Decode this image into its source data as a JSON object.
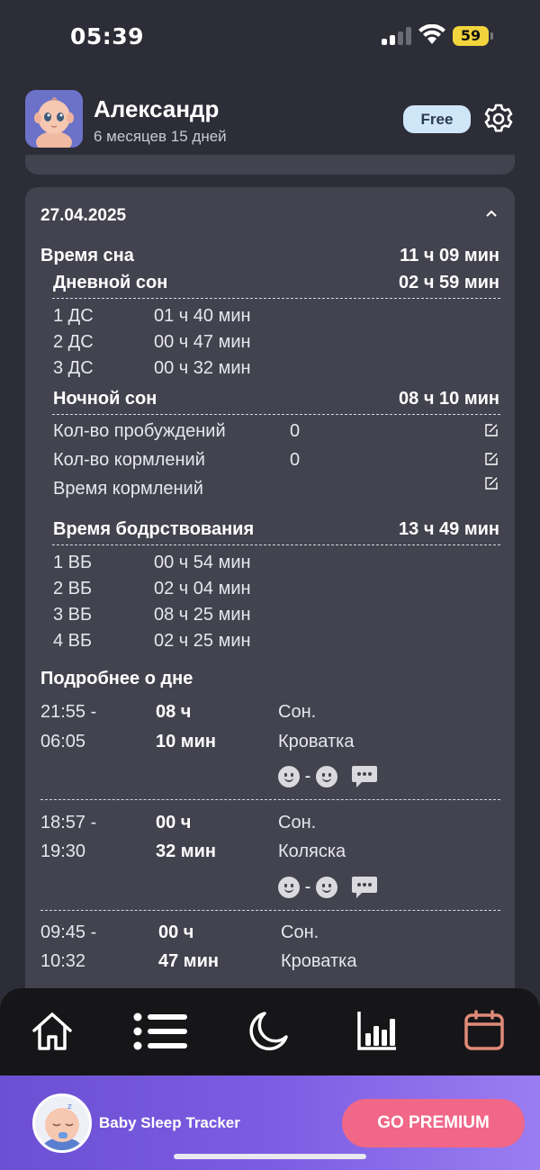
{
  "status_bar": {
    "time": "05:39",
    "battery": "59"
  },
  "header": {
    "name": "Александр",
    "age": "6 месяцев 15 дней",
    "plan_badge": "Free"
  },
  "card": {
    "date": "27.04.2025",
    "sleep_total": {
      "label": "Время сна",
      "value": "11 ч 09 мин"
    },
    "day_sleep": {
      "label": "Дневной сон",
      "value": "02 ч 59 мин",
      "items": [
        {
          "name": "1 ДС",
          "duration": "01 ч 40 мин"
        },
        {
          "name": "2 ДС",
          "duration": "00 ч 47 мин"
        },
        {
          "name": "3 ДС",
          "duration": "00 ч 32 мин"
        }
      ]
    },
    "night_sleep": {
      "label": "Ночной сон",
      "value": "08 ч 10 мин",
      "items": [
        {
          "name": "Кол-во пробуждений",
          "value": "0"
        },
        {
          "name": "Кол-во кормлений",
          "value": "0"
        },
        {
          "name": "Время кормлений",
          "value": ""
        }
      ]
    },
    "awake": {
      "label": "Время бодрствования",
      "value": "13 ч 49 мин",
      "items": [
        {
          "name": "1 ВБ",
          "duration": "00 ч 54 мин"
        },
        {
          "name": "2 ВБ",
          "duration": "02 ч 04 мин"
        },
        {
          "name": "3 ВБ",
          "duration": "08 ч 25 мин"
        },
        {
          "name": "4 ВБ",
          "duration": "02 ч 25 мин"
        }
      ]
    },
    "details_title": "Подробнее о дне",
    "details": [
      {
        "start": "21:55 -",
        "end": "06:05",
        "hours": "08 ч",
        "minutes": "10 мин",
        "type": "Сон.",
        "place": "Кроватка"
      },
      {
        "start": "18:57 -",
        "end": "19:30",
        "hours": "00 ч",
        "minutes": "32 мин",
        "type": "Сон.",
        "place": "Коляска"
      },
      {
        "start": "09:45 -",
        "end": "10:32",
        "hours": "00 ч",
        "minutes": "47 мин",
        "type": "Сон.",
        "place": "Кроватка"
      }
    ],
    "mood_separator": "-"
  },
  "nav": {
    "items": [
      {
        "icon": "home-icon"
      },
      {
        "icon": "list-icon"
      },
      {
        "icon": "moon-icon"
      },
      {
        "icon": "chart-icon"
      },
      {
        "icon": "calendar-icon"
      }
    ],
    "active_color": "#e08a78"
  },
  "premium": {
    "title": "Baby Sleep Tracker",
    "button": "GO PREMIUM"
  }
}
